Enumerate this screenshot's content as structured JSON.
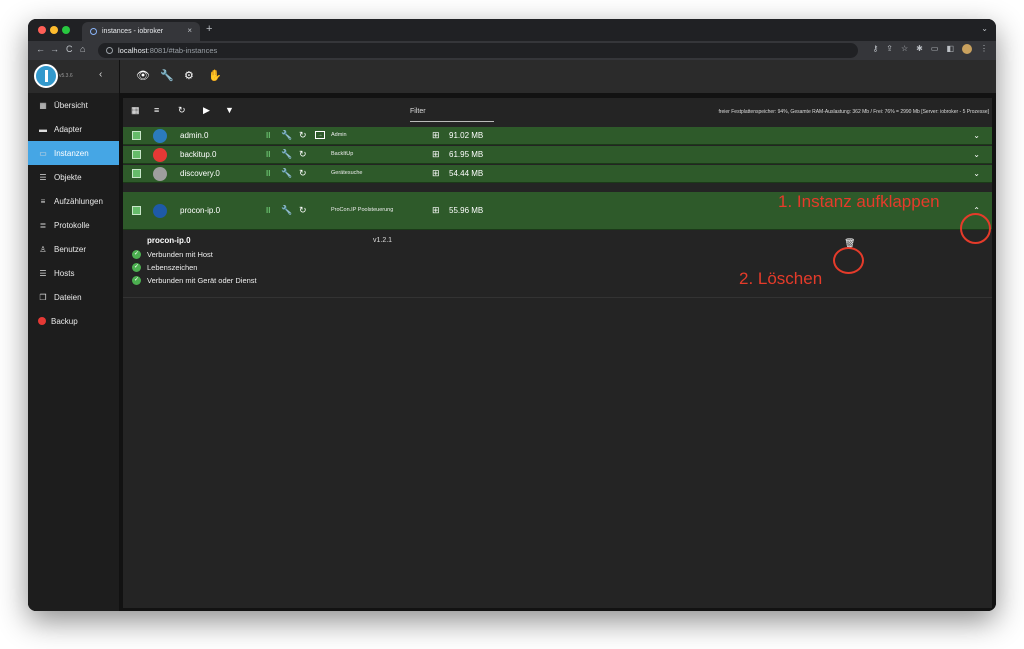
{
  "browser": {
    "tab_title": "instances - iobroker",
    "new_tab": "+",
    "tab_close": "×",
    "address_host": "localhost",
    "address_rest": ":8081/#tab-instances",
    "nav_back": "←",
    "nav_forward": "→",
    "nav_reload": "C",
    "nav_home": "⌂"
  },
  "app": {
    "version": "v5.3.6",
    "collapse_label": "‹"
  },
  "sidebar": {
    "items": [
      {
        "label": "Übersicht",
        "icon": "grid-icon",
        "glyph": "▦"
      },
      {
        "label": "Adapter",
        "icon": "store-icon",
        "glyph": "▬"
      },
      {
        "label": "Instanzen",
        "icon": "instances-icon",
        "glyph": "▭"
      },
      {
        "label": "Objekte",
        "icon": "list-icon",
        "glyph": "☰"
      },
      {
        "label": "Aufzählungen",
        "icon": "enum-icon",
        "glyph": "≡"
      },
      {
        "label": "Protokolle",
        "icon": "log-icon",
        "glyph": "≣"
      },
      {
        "label": "Benutzer",
        "icon": "user-icon",
        "glyph": "♙"
      },
      {
        "label": "Hosts",
        "icon": "hosts-icon",
        "glyph": "☰"
      },
      {
        "label": "Dateien",
        "icon": "files-icon",
        "glyph": "❐"
      },
      {
        "label": "Backup",
        "icon": "backup-icon",
        "glyph": ""
      }
    ]
  },
  "topbar": {
    "icons": [
      "👁",
      "🔧",
      "⚙",
      "✋"
    ]
  },
  "toolbar": {
    "filter_label": "Filter",
    "system_info": "freier Festplattenspeicher: 94%, Gesamte RAM-Auslastung: 362 Mb / Frei: 76% = 2990 Mb [Server: iobroker - 5 Prozesse]"
  },
  "instances": [
    {
      "name": "admin.0",
      "title": "Admin",
      "memory": "91.02 MB",
      "has_login": true,
      "icon_color": "#2b7bbd"
    },
    {
      "name": "backitup.0",
      "title": "BackItUp",
      "memory": "61.95 MB",
      "has_login": false,
      "icon_color": "#e53935"
    },
    {
      "name": "discovery.0",
      "title": "Gerätesuche",
      "memory": "54.44 MB",
      "has_login": false,
      "icon_color": "#9e9e9e"
    },
    {
      "name": "procon-ip.0",
      "title": "ProCon.IP Poolsteuerung",
      "memory": "55.96 MB",
      "has_login": false,
      "icon_color": "#1e5aa8"
    }
  ],
  "detail": {
    "name": "procon-ip.0",
    "version": "v1.2.1",
    "status": [
      "Verbunden mit Host",
      "Lebenszeichen",
      "Verbunden mit Gerät oder Dienst"
    ]
  },
  "annotations": {
    "step1": "1. Instanz aufklappen",
    "step2": "2. Löschen",
    "color": "#e53b2a"
  }
}
